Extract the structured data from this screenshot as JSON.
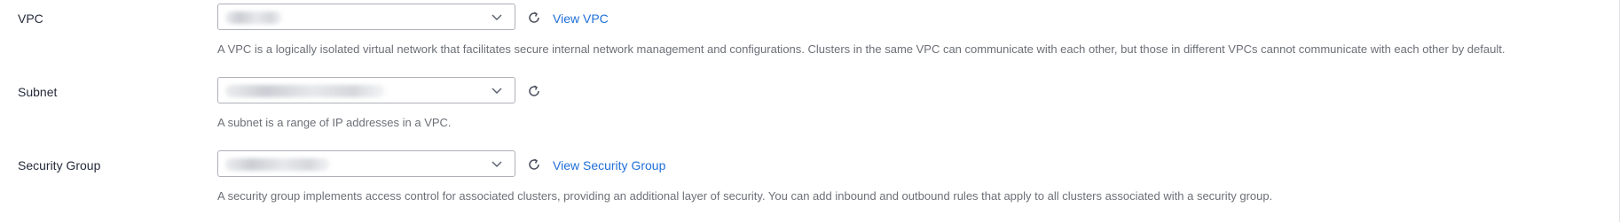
{
  "vpc": {
    "label": "VPC",
    "link": "View VPC",
    "hint": "A VPC is a logically isolated virtual network that facilitates secure internal network management and configurations. Clusters in the same VPC can communicate with each other, but those in different VPCs cannot communicate with each other by default."
  },
  "subnet": {
    "label": "Subnet",
    "hint": "A subnet is a range of IP addresses in a VPC."
  },
  "security_group": {
    "label": "Security Group",
    "link": "View Security Group",
    "hint": "A security group implements access control for associated clusters, providing an additional layer of security. You can add inbound and outbound rules that apply to all clusters associated with a security group."
  },
  "icons": {
    "dropdown": "chevron-down-icon",
    "refresh": "refresh-icon"
  },
  "colors": {
    "link": "#1f6fd8",
    "label": "#252b3a",
    "hint": "#6c6f76",
    "border": "#adb0b8"
  }
}
